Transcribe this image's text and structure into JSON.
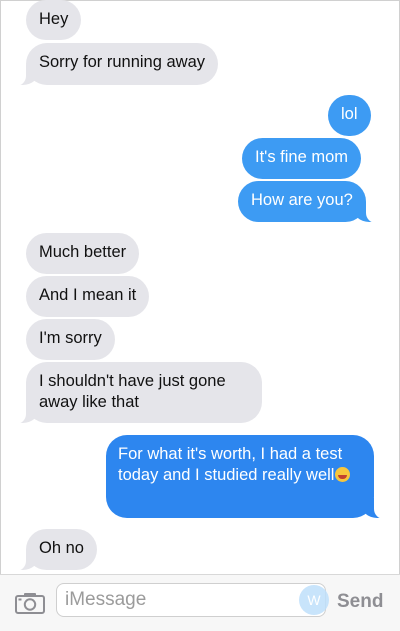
{
  "messages": [
    {
      "text": "Hey"
    },
    {
      "text": "Sorry for running away"
    },
    {
      "text": "lol"
    },
    {
      "text": "It's fine mom"
    },
    {
      "text": "How are you?"
    },
    {
      "text": "Much better"
    },
    {
      "text": "And I mean it"
    },
    {
      "text": "I'm sorry"
    },
    {
      "text": "I shouldn't have just gone away like that"
    },
    {
      "text": "For what it's worth, I had a test today and I studied really well"
    },
    {
      "text": "Oh no"
    }
  ],
  "input": {
    "placeholder": "iMessage",
    "send_label": "Send",
    "ghost_glyph": "W"
  },
  "colors": {
    "incoming": "#e5e5ea",
    "outgoing": "#3d9bf3",
    "outgoing_dark": "#2d86ef"
  },
  "icons": {
    "camera": "camera-icon",
    "emoji": "laughing-emoji-icon"
  }
}
